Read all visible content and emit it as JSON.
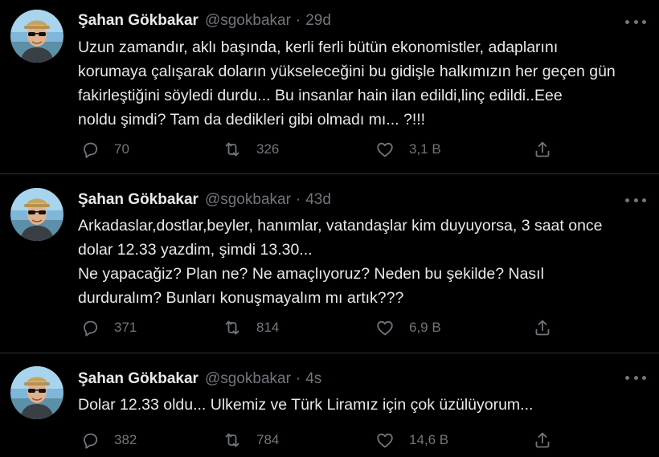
{
  "colors": {
    "background": "#000000",
    "text": "#e7e9ea",
    "muted": "#71767b",
    "divider": "#2f3336"
  },
  "tweets": [
    {
      "name": "Şahan Gökbakar",
      "handle": "@sgokbakar",
      "separator": "·",
      "time": "29d",
      "text": "Uzun zamandır, aklı başında, kerli ferli bütün ekonomistler, adaplarını\nkorumaya çalışarak doların yükseleceğini bu gidişle halkımızın her geçen gün\nfakirleştiğini söyledi durdu... Bu insanlar hain ilan edildi,linç edildi..Eee\nnoldu şimdi? Tam da dedikleri gibi olmadı mı... ?!!!",
      "replies": "70",
      "retweets": "326",
      "likes": "3,1 B"
    },
    {
      "name": "Şahan Gökbakar",
      "handle": "@sgokbakar",
      "separator": "·",
      "time": "43d",
      "text": "Arkadaslar,dostlar,beyler, hanımlar, vatandaşlar kim duyuyorsa, 3 saat once\ndolar 12.33 yazdim, şimdi  13.30...\nNe yapacağiz? Plan ne? Ne amaçlıyoruz? Neden bu şekilde? Nasıl\ndurduralım? Bunları konuşmayalım mı artık???",
      "replies": "371",
      "retweets": "814",
      "likes": "6,9 B"
    },
    {
      "name": "Şahan Gökbakar",
      "handle": "@sgokbakar",
      "separator": "·",
      "time": "4s",
      "text": "Dolar 12.33 oldu... Ulkemiz ve Türk Liramız için çok üzülüyorum...",
      "replies": "382",
      "retweets": "784",
      "likes": "14,6 B"
    }
  ],
  "icons": {
    "reply": "reply-icon",
    "retweet": "retweet-icon",
    "like": "heart-icon",
    "share": "share-icon",
    "more": "more-icon"
  }
}
